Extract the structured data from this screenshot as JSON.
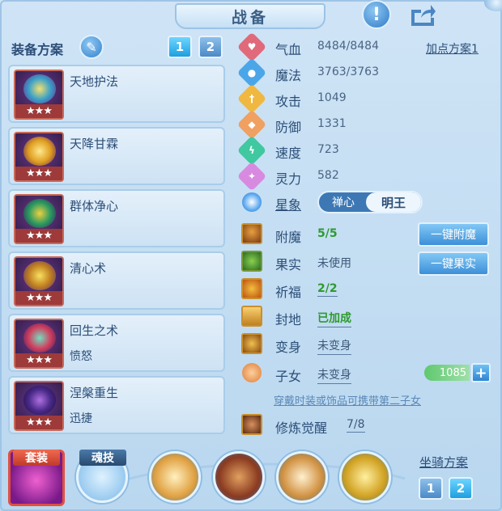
{
  "header": {
    "title": "战备"
  },
  "plan": {
    "title": "装备方案",
    "buttons": [
      "1",
      "2"
    ]
  },
  "skills": [
    {
      "name": "天地护法",
      "sub": "",
      "stars": "★★★"
    },
    {
      "name": "天降甘霖",
      "sub": "",
      "stars": "★★★"
    },
    {
      "name": "群体净心",
      "sub": "",
      "stars": "★★★"
    },
    {
      "name": "清心术",
      "sub": "",
      "stars": "★★★"
    },
    {
      "name": "回生之术",
      "sub": "愤怒",
      "stars": "★★★"
    },
    {
      "name": "涅槃重生",
      "sub": "迅捷",
      "stars": "★★★"
    }
  ],
  "stats": {
    "hp": {
      "label": "气血",
      "value": "8484/8484"
    },
    "mp": {
      "label": "魔法",
      "value": "3763/3763"
    },
    "atk": {
      "label": "攻击",
      "value": "1049"
    },
    "def": {
      "label": "防御",
      "value": "1331"
    },
    "spd": {
      "label": "速度",
      "value": "723"
    },
    "spr": {
      "label": "灵力",
      "value": "582"
    },
    "add_plan": "加点方案1"
  },
  "star_sign": {
    "label": "星象",
    "options": [
      "禅心",
      "明王"
    ]
  },
  "extras": {
    "enchant": {
      "label": "附魔",
      "value": "5/5"
    },
    "fruit": {
      "label": "果实",
      "value": "未使用"
    },
    "pray": {
      "label": "祈福",
      "value": "2/2"
    },
    "seal": {
      "label": "封地",
      "value": "已加成"
    },
    "transform": {
      "label": "变身",
      "value": "未变身"
    },
    "child": {
      "label": "子女",
      "value": "未变身"
    },
    "cultivate": {
      "label": "修炼觉醒",
      "value": "7/8"
    }
  },
  "buttons": {
    "enchant_all": "一键附魔",
    "fruit_all": "一键果实"
  },
  "child_counter": "1085",
  "hint": "穿戴时装或饰品可携带第二子女",
  "bottom": {
    "slot1": "套装",
    "slot2": "魂技",
    "mount_title": "坐骑方案",
    "mount_buttons": [
      "1",
      "2"
    ]
  }
}
